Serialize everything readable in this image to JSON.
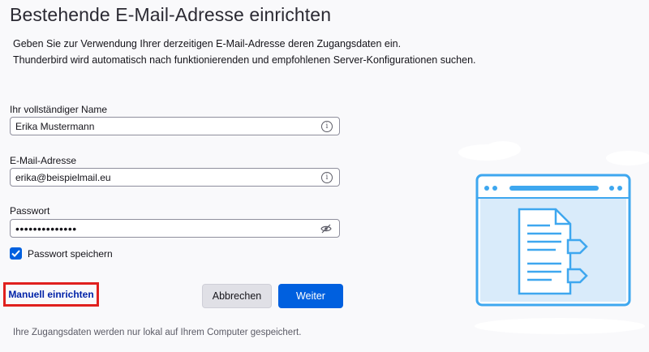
{
  "page": {
    "title": "Bestehende E-Mail-Adresse einrichten",
    "intro_line1": "Geben Sie zur Verwendung Ihrer derzeitigen E-Mail-Adresse deren Zugangsdaten ein.",
    "intro_line2": "Thunderbird wird automatisch nach funktionierenden und empfohlenen Server-Konfigurationen suchen."
  },
  "form": {
    "name_label": "Ihr vollständiger Name",
    "name_value": "Erika Mustermann",
    "email_label": "E-Mail-Adresse",
    "email_value": "erika@beispielmail.eu",
    "password_label": "Passwort",
    "password_value": "••••••••••••••",
    "remember_label": "Passwort speichern",
    "remember_checked": true
  },
  "actions": {
    "manual_label": "Manuell einrichten",
    "cancel_label": "Abbrechen",
    "next_label": "Weiter"
  },
  "footer": {
    "note": "Ihre Zugangsdaten werden nur lokal auf Ihrem Computer gespeichert."
  },
  "icons": {
    "info": "info-icon",
    "eye_slash": "eye-slash-icon",
    "check": "checkmark-icon"
  },
  "colors": {
    "accent": "#0060df",
    "highlight": "#e0201e",
    "link": "#0022a8"
  }
}
